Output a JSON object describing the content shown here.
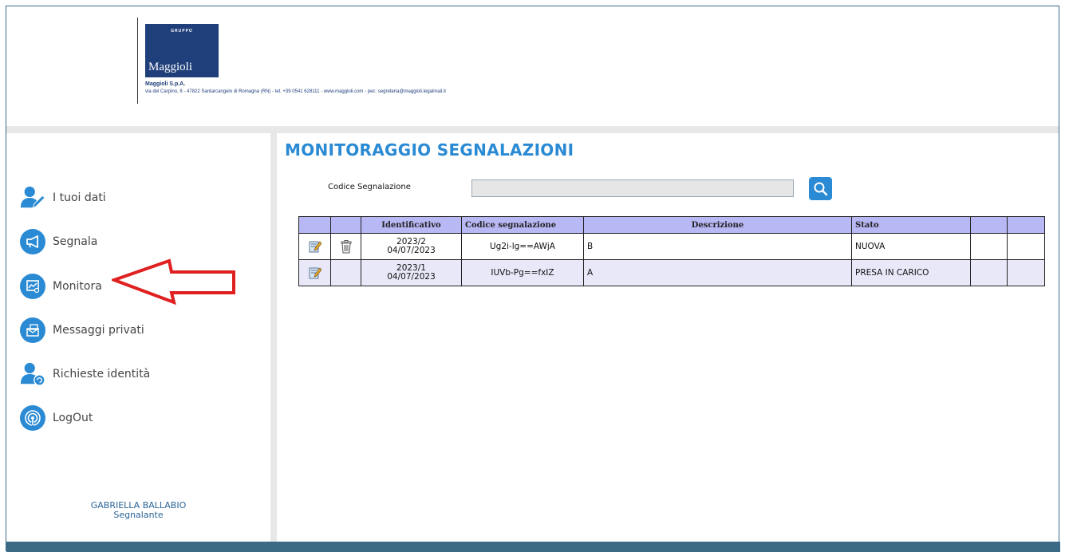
{
  "header": {
    "logo_top_text": "GRUPPO",
    "logo_name": "Maggioli",
    "company_name": "Maggioli S.p.A.",
    "company_address": "via del Carpino, 8 - 47822 Santarcangelo di Romagna (RN) - tel. +39 0541 628111 - www.maggioli.com - pec: segreteria@maggioli.legalmail.it"
  },
  "sidebar": {
    "items": [
      {
        "label": "I tuoi dati",
        "icon": "user-edit-icon"
      },
      {
        "label": "Segnala",
        "icon": "megaphone-icon"
      },
      {
        "label": "Monitora",
        "icon": "monitor-chart-icon"
      },
      {
        "label": "Messaggi privati",
        "icon": "private-messages-icon"
      },
      {
        "label": "Richieste identità",
        "icon": "user-identity-icon"
      },
      {
        "label": "LogOut",
        "icon": "logout-signal-icon"
      }
    ],
    "user_name": "GABRIELLA BALLABIO",
    "user_role": "Segnalante"
  },
  "main": {
    "title": "MONITORAGGIO SEGNALAZIONI",
    "search_label": "Codice Segnalazione",
    "search_value": "",
    "table": {
      "headers": [
        "",
        "",
        "Identificativo",
        "Codice segnalazione",
        "Descrizione",
        "Stato",
        "",
        ""
      ],
      "rows": [
        {
          "id": "2023/2",
          "date": "04/07/2023",
          "code": "Ug2i-lg==AWjA",
          "description": "B",
          "status": "NUOVA",
          "has_delete": true
        },
        {
          "id": "2023/1",
          "date": "04/07/2023",
          "code": "IUVb-Pg==fxIZ",
          "description": "A",
          "status": "PRESA IN CARICO",
          "has_delete": false
        }
      ]
    }
  },
  "colors": {
    "accent": "#2a8ad4",
    "table_header": "#b8b8f5",
    "row_alt": "#e8e8f8",
    "footer": "#3a6a84",
    "arrow": "#e02020"
  }
}
